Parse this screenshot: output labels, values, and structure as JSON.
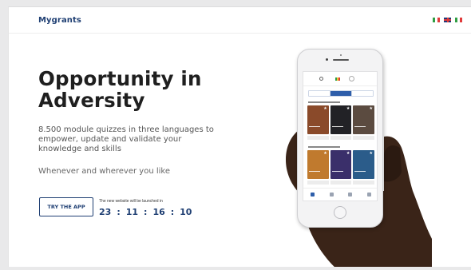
{
  "header": {
    "brand": "Mygrants",
    "languages": [
      {
        "name": "italian",
        "colors": [
          "#2f9e44",
          "#ffffff",
          "#e03a3a"
        ]
      },
      {
        "name": "english",
        "colors": [
          "#1f3a7a",
          "#ffffff",
          "#e03a3a"
        ]
      },
      {
        "name": "italian",
        "colors": [
          "#2f9e44",
          "#ffffff",
          "#e03a3a"
        ]
      }
    ]
  },
  "hero": {
    "title": "Opportunity in Adversity",
    "description": "8.500 module quizzes in three languages to empower, update and validate your knowledge and skills",
    "tagline": "Whenever and wherever you like",
    "cta_label": "TRY THE APP",
    "launch_note": "The new website will be launched in",
    "countdown": {
      "days": "23",
      "hours": "11",
      "minutes": "16",
      "seconds": "10",
      "separator": ":"
    }
  },
  "phone_mockup": {
    "card_colors_row1": [
      "#8a4a2a",
      "#222226",
      "#5b4b40"
    ],
    "card_colors_row2": [
      "#c07a2e",
      "#3a2f6a",
      "#2b5c8a"
    ],
    "accent": "#2e5eaa"
  },
  "colors": {
    "brand": "#1f3f73",
    "title": "#1f1f1f",
    "skin": "#3a2418"
  }
}
